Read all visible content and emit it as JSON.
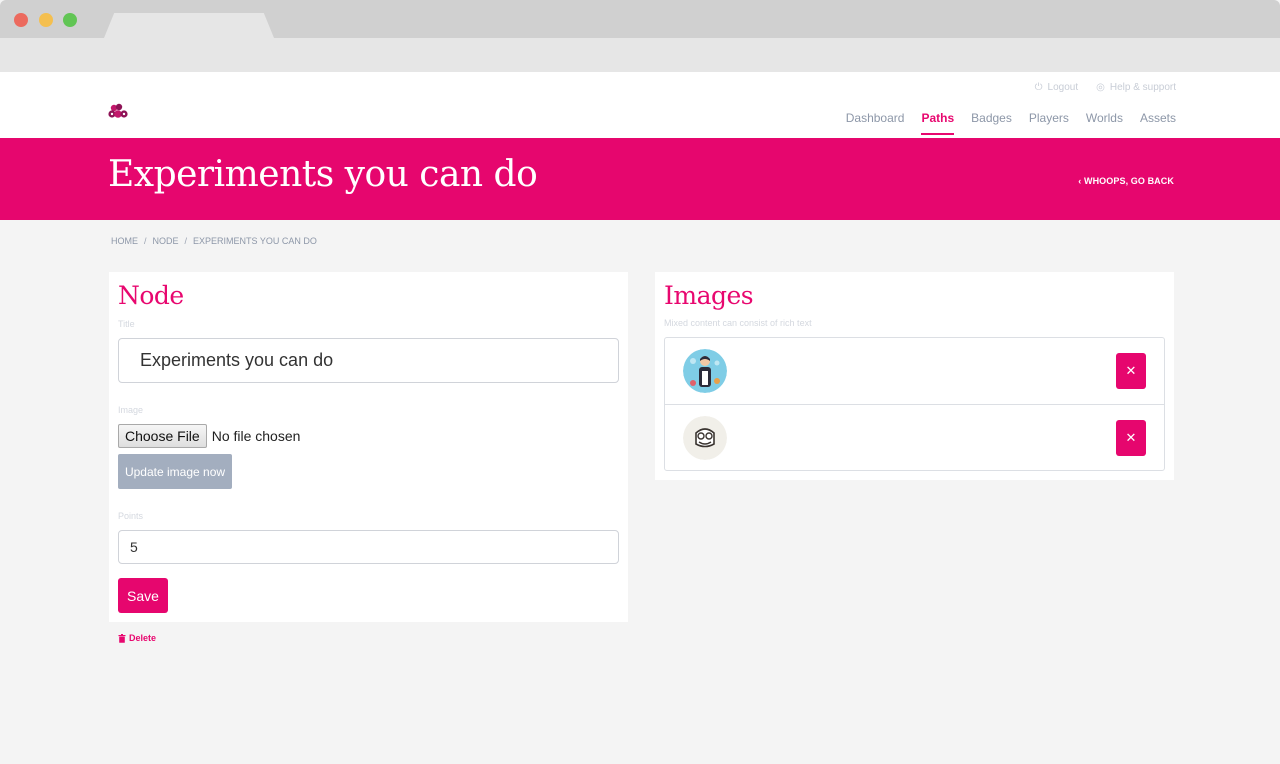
{
  "header": {
    "util_links": {
      "logout": "Logout",
      "help": "Help & support"
    },
    "nav": [
      {
        "label": "Dashboard",
        "active": false
      },
      {
        "label": "Paths",
        "active": true
      },
      {
        "label": "Badges",
        "active": false
      },
      {
        "label": "Players",
        "active": false
      },
      {
        "label": "Worlds",
        "active": false
      },
      {
        "label": "Assets",
        "active": false
      }
    ]
  },
  "hero": {
    "title": "Experiments you can do",
    "back_label": "WHOOPS, GO BACK"
  },
  "breadcrumb": [
    "HOME",
    "NODE",
    "EXPERIMENTS YOU CAN DO"
  ],
  "node_panel": {
    "title": "Node",
    "title_label": "Title",
    "title_value": "Experiments you can do",
    "image_label": "Image",
    "choose_file_label": "Choose File",
    "no_file_text": "No file chosen",
    "update_image_label": "Update image now",
    "points_label": "Points",
    "points_value": "5",
    "save_label": "Save",
    "delete_label": "Delete"
  },
  "images_panel": {
    "title": "Images",
    "subtitle": "Mixed content can consist of rich text",
    "items": [
      {
        "thumbnail": "person-avatar-illustration",
        "remove_icon": "close-icon"
      },
      {
        "thumbnail": "owl-face-illustration",
        "remove_icon": "close-icon"
      }
    ]
  },
  "colors": {
    "brand_pink": "#e6066e",
    "nav_gray": "#8d97a8",
    "button_gray": "#a3aebf",
    "background": "#f4f4f4"
  }
}
